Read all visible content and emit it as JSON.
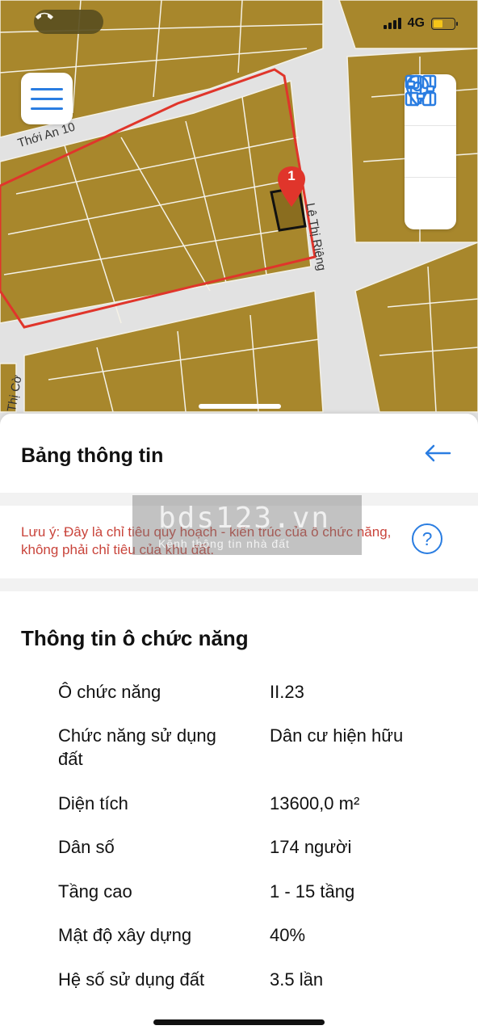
{
  "status_bar": {
    "call_icon": "phone-icon",
    "network": "4G",
    "battery_color": "#f5c518"
  },
  "map": {
    "streets": {
      "thoi_an": "Thới An 10",
      "le_thi_rieng": "Lê Thị Riêng",
      "thi_co": "Thị Cờ"
    },
    "marker_number": "1",
    "colors": {
      "block": "#a8872c",
      "road": "#e2e2e2",
      "boundary": "#e0352b",
      "accent": "#2a7de1"
    },
    "icons": {
      "menu": "menu-icon",
      "grid": "grid-icon",
      "location": "location-pin-icon",
      "layers": "sliders-icon"
    }
  },
  "sheet": {
    "title": "Bảng thông tin",
    "back_icon": "arrow-left-icon",
    "note": "Lưu ý: Đây là chỉ tiêu quy hoạch - kiến trúc của ô chức năng, không phải chỉ tiêu của khu đất.",
    "help_icon": "question-mark",
    "help_label": "?",
    "watermark": {
      "main": "bds123.vn",
      "sub": "Kênh thông tin nhà đất"
    },
    "section_title": "Thông tin ô chức năng",
    "rows": [
      {
        "label": "Ô chức năng",
        "value": "II.23"
      },
      {
        "label": "Chức năng sử dụng đất",
        "value": "Dân cư hiện hữu"
      },
      {
        "label": "Diện tích",
        "value": "13600,0 m²"
      },
      {
        "label": "Dân số",
        "value": "174 người"
      },
      {
        "label": "Tầng cao",
        "value": "1 - 15 tầng"
      },
      {
        "label": "Mật độ xây dựng",
        "value": "40%"
      },
      {
        "label": "Hệ số sử dụng đất",
        "value": "3.5 lần"
      }
    ]
  }
}
